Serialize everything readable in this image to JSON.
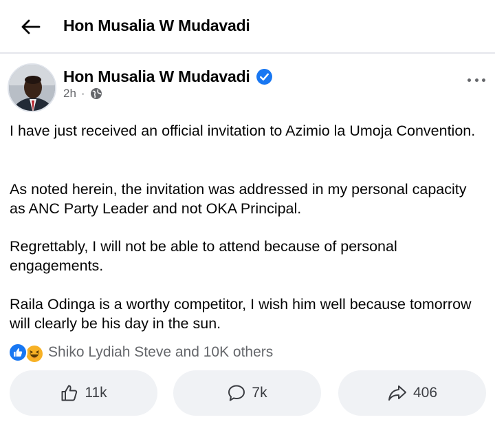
{
  "header": {
    "title": "Hon Musalia W Mudavadi"
  },
  "post": {
    "author": "Hon Musalia W Mudavadi",
    "time": "2h",
    "dot": "·",
    "paragraphs": [
      "I have just received an official invitation to Azimio la Umoja Convention.",
      "As noted herein, the invitation was addressed in my personal capacity as ANC Party Leader and not OKA Principal.",
      "Regrettably, I will not be able to attend because of personal engagements.",
      "Raila Odinga is a worthy competitor, I wish him well because tomorrow will clearly be his day in the sun."
    ],
    "reactions_text": "Shiko Lydiah Steve and 10K others"
  },
  "actions": {
    "likes": "11k",
    "comments": "7k",
    "shares": "406"
  },
  "icons": {
    "back": "back-arrow-icon",
    "verified": "verified-badge-icon",
    "privacy": "globe-icon",
    "more": "more-options-icon",
    "like_reaction": "like-reaction-icon",
    "haha_reaction": "haha-reaction-icon",
    "like_action": "thumbs-up-icon",
    "comment_action": "comment-bubble-icon",
    "share_action": "share-arrow-icon"
  },
  "colors": {
    "accent": "#1877f2",
    "muted": "#65676b",
    "button_bg": "#f0f2f5",
    "haha": "#f7b125"
  }
}
